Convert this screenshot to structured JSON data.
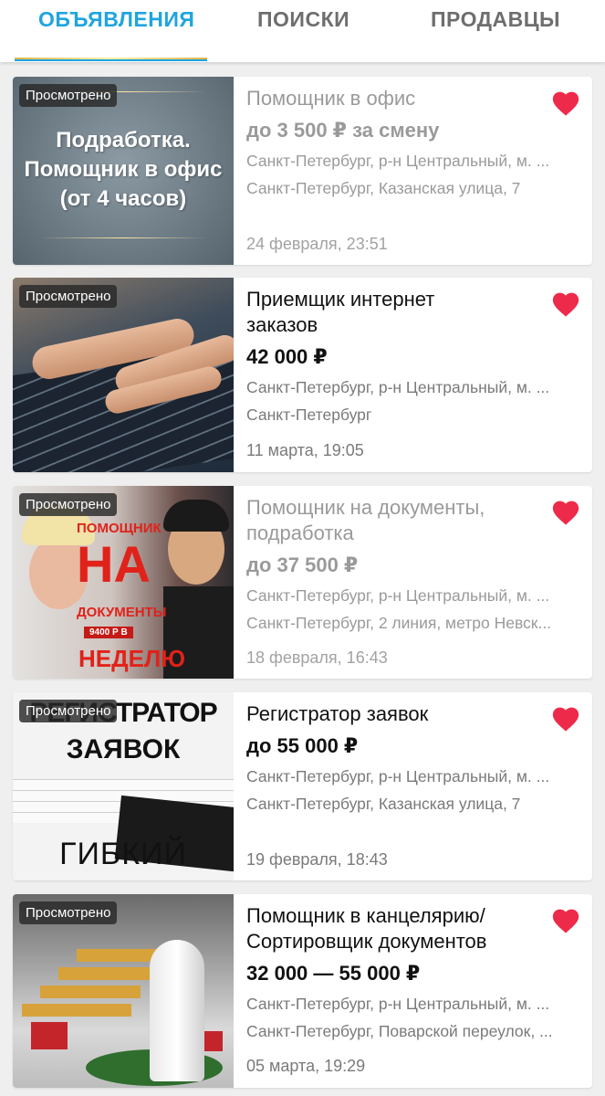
{
  "tabs": [
    {
      "label": "ОБЪЯВЛЕНИЯ",
      "active": true
    },
    {
      "label": "ПОИСКИ",
      "active": false
    },
    {
      "label": "ПРОДАВЦЫ",
      "active": false
    }
  ],
  "colors": {
    "accent": "#1fa5de",
    "heart": "#ee2a4a"
  },
  "badge_label": "Просмотрено",
  "listings": [
    {
      "title": "Помощник в офис",
      "price": "до 3 500 ₽ за смену",
      "location": "Санкт-Петербург, р-н Центральный, м. ...",
      "address": "Санкт-Петербург, Казанская улица, 7",
      "date": "24 февраля, 23:51",
      "image_text": [
        "Подработка.",
        "Помощник в офис",
        "(от 4 часов)"
      ]
    },
    {
      "title": "Приемщик интернет заказов",
      "price": "42 000 ₽",
      "location": "Санкт-Петербург, р-н Центральный, м. ...",
      "address": "Санкт-Петербург",
      "date": "11 марта, 19:05"
    },
    {
      "title": "Помощник на документы, подработка",
      "price": "до 37 500 ₽",
      "location": "Санкт-Петербург, р-н Центральный, м. ...",
      "address": "Санкт-Петербург, 2 линия, метро Невск...",
      "date": "18 февраля, 16:43",
      "image_text": [
        "ПОМОЩНИК",
        "НА",
        "ДОКУМЕНТЫ",
        "9400 Р В",
        "НЕДЕЛЮ"
      ]
    },
    {
      "title": "Регистратор заявок",
      "price": "до 55 000 ₽",
      "location": "Санкт-Петербург, р-н Центральный, м. ...",
      "address": "Санкт-Петербург, Казанская улица, 7",
      "date": "19 февраля, 18:43",
      "image_text": [
        "РЕГИСТРАТОР",
        "ЗАЯВОК",
        "ГИБКИЙ"
      ]
    },
    {
      "title": "Помощник в канцелярию/ Сортировщик документов",
      "price": "32 000 — 55 000 ₽",
      "location": "Санкт-Петербург, р-н Центральный, м. ...",
      "address": "Санкт-Петербург, Поварской переулок, ...",
      "date": "05 марта, 19:29"
    }
  ]
}
